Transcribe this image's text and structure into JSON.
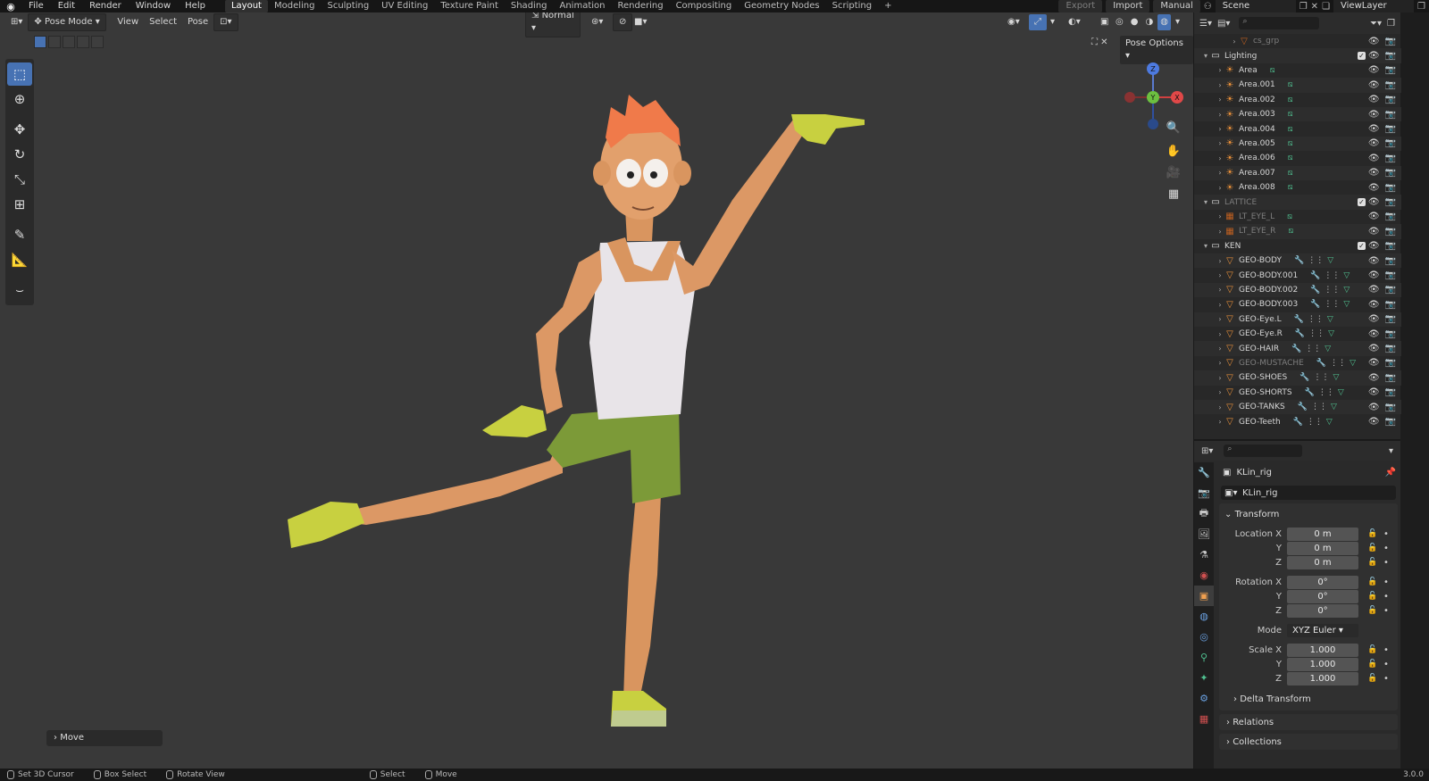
{
  "topbar": {
    "menus": [
      "File",
      "Edit",
      "Render",
      "Window",
      "Help"
    ],
    "workspaces": [
      "Layout",
      "Modeling",
      "Sculpting",
      "UV Editing",
      "Texture Paint",
      "Shading",
      "Animation",
      "Rendering",
      "Compositing",
      "Geometry Nodes",
      "Scripting",
      "+"
    ],
    "active_workspace": "Layout",
    "export_label": "Export",
    "import_label": "Import",
    "manual_label": "Manual",
    "scene_label": "Scene",
    "viewlayer_label": "ViewLayer"
  },
  "viewport_header": {
    "mode": "Pose Mode",
    "menus": [
      "View",
      "Select",
      "Pose"
    ],
    "orientation": "Normal",
    "pose_options": "Pose Options",
    "last_op": "Move"
  },
  "gizmo": {
    "z": "Z",
    "y": "Y",
    "x": "X"
  },
  "outliner": {
    "rows": [
      {
        "name": "cs_grp",
        "icon": "object-icon",
        "depth": 2,
        "dim": true,
        "mods": ""
      },
      {
        "name": "Lighting",
        "icon": "collection-icon",
        "depth": 0,
        "expanded": true,
        "check": true
      },
      {
        "name": "Area",
        "icon": "light-icon",
        "depth": 1
      },
      {
        "name": "Area.001",
        "icon": "light-icon",
        "depth": 1
      },
      {
        "name": "Area.002",
        "icon": "light-icon",
        "depth": 1
      },
      {
        "name": "Area.003",
        "icon": "light-icon",
        "depth": 1
      },
      {
        "name": "Area.004",
        "icon": "light-icon",
        "depth": 1
      },
      {
        "name": "Area.005",
        "icon": "light-icon",
        "depth": 1
      },
      {
        "name": "Area.006",
        "icon": "light-icon",
        "depth": 1
      },
      {
        "name": "Area.007",
        "icon": "light-icon",
        "depth": 1
      },
      {
        "name": "Area.008",
        "icon": "light-icon",
        "depth": 1
      },
      {
        "name": "LATTICE",
        "icon": "collection-icon",
        "depth": 0,
        "expanded": true,
        "check": true,
        "dim": true
      },
      {
        "name": "LT_EYE_L",
        "icon": "lattice-icon",
        "depth": 1,
        "dim": true
      },
      {
        "name": "LT_EYE_R",
        "icon": "lattice-icon",
        "depth": 1,
        "dim": true
      },
      {
        "name": "KEN",
        "icon": "collection-icon",
        "depth": 0,
        "expanded": true,
        "check": true
      },
      {
        "name": "GEO-BODY",
        "icon": "mesh-icon",
        "depth": 1,
        "mods": true
      },
      {
        "name": "GEO-BODY.001",
        "icon": "mesh-icon",
        "depth": 1,
        "mods": true
      },
      {
        "name": "GEO-BODY.002",
        "icon": "mesh-icon",
        "depth": 1,
        "mods": true
      },
      {
        "name": "GEO-BODY.003",
        "icon": "mesh-icon",
        "depth": 1,
        "mods": true
      },
      {
        "name": "GEO-Eye.L",
        "icon": "mesh-icon",
        "depth": 1,
        "mods": true
      },
      {
        "name": "GEO-Eye.R",
        "icon": "mesh-icon",
        "depth": 1,
        "mods": true
      },
      {
        "name": "GEO-HAIR",
        "icon": "mesh-icon",
        "depth": 1,
        "mods": true
      },
      {
        "name": "GEO-MUSTACHE",
        "icon": "mesh-icon",
        "depth": 1,
        "mods": true,
        "dim": true
      },
      {
        "name": "GEO-SHOES",
        "icon": "mesh-icon",
        "depth": 1,
        "mods": true
      },
      {
        "name": "GEO-SHORTS",
        "icon": "mesh-icon",
        "depth": 1,
        "mods": true
      },
      {
        "name": "GEO-TANKS",
        "icon": "mesh-icon",
        "depth": 1,
        "mods": true
      },
      {
        "name": "GEO-Teeth",
        "icon": "mesh-icon",
        "depth": 1,
        "mods": true
      }
    ]
  },
  "properties": {
    "object_name": "KLin_rig",
    "data_name": "KLin_rig",
    "transform_label": "Transform",
    "location": {
      "label": "Location X",
      "x": "0 m",
      "y": "0 m",
      "z": "0 m"
    },
    "rotation": {
      "label": "Rotation X",
      "x": "0°",
      "y": "0°",
      "z": "0°"
    },
    "mode_label": "Mode",
    "mode_value": "XYZ Euler",
    "scale": {
      "label": "Scale X",
      "x": "1.000",
      "y": "1.000",
      "z": "1.000"
    },
    "axis_y": "Y",
    "axis_z": "Z",
    "delta_transform": "Delta Transform",
    "relations": "Relations",
    "collections": "Collections"
  },
  "statusbar": {
    "items": [
      "Set 3D Cursor",
      "Box Select",
      "Rotate View",
      "Select",
      "Move"
    ],
    "version": "3.0.0"
  },
  "colors": {
    "accent": "#4772b3",
    "viewport_bg": "#393939",
    "skin": "#e2a06c",
    "tank": "#e8e4e8",
    "shorts": "#7c9a38",
    "hair": "#f07a4a",
    "gloves": "#c8d040"
  }
}
